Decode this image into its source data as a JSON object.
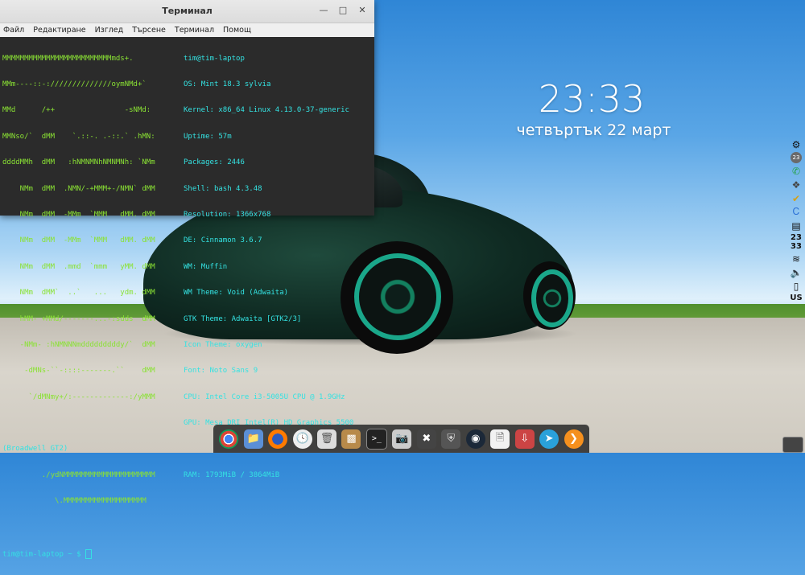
{
  "window": {
    "title": "Терминал",
    "controls": [
      "minimize-icon",
      "maximize-icon",
      "close-icon"
    ],
    "menu": [
      "Файл",
      "Редактиране",
      "Изглед",
      "Търсене",
      "Терминал",
      "Помощ"
    ]
  },
  "terminal": {
    "logo_lines": [
      "MMMMMMMMMMMMMMMMMMMMMMMMMmds+.",
      "MMm----::-://////////////oymNMd+`",
      "MMd      /++                -sNMd:",
      "MMNso/`  dMM    `.::-. .-::.` .hMN:",
      "ddddMMh  dMM   :hNMNMNhNMNMNh: `NMm",
      "    NMm  dMM  .NMN/-+MMM+-/NMN` dMM",
      "    NMm  dMM  -MMm  `MMM   dMM. dMM",
      "    NMm  dMM  -MMm  `MMM   dMM. dMM",
      "    NMm  dMM  .mmd  `mmm   yMM. dMM",
      "    NMm  dMM`  ..`   ...   ydm. dMM",
      "    hMM- +MMd/-------...-:sdds  dMM",
      "    -NMm- :hNMNNNmdddddddddy/`  dMM",
      "     -dMNs-``-::::-------.``    dMM",
      "      `/dMNmy+/:-------------:/yMMM",
      "",
      "         ./ydNMMMMMMMMMMMMMMMMMMMMM",
      "            \\.MMMMMMMMMMMMMMMMMMM"
    ],
    "user_host": "tim@tim-laptop",
    "info": [
      {
        "label": "OS:",
        "value": "Mint 18.3 sylvia"
      },
      {
        "label": "Kernel:",
        "value": "x86_64 Linux 4.13.0-37-generic"
      },
      {
        "label": "Uptime:",
        "value": "57m"
      },
      {
        "label": "Packages:",
        "value": "2446"
      },
      {
        "label": "Shell:",
        "value": "bash 4.3.48"
      },
      {
        "label": "Resolution:",
        "value": "1366x768"
      },
      {
        "label": "DE:",
        "value": "Cinnamon 3.6.7"
      },
      {
        "label": "WM:",
        "value": "Muffin"
      },
      {
        "label": "WM Theme:",
        "value": "Void (Adwaita)"
      },
      {
        "label": "GTK Theme:",
        "value": "Adwaita [GTK2/3]"
      },
      {
        "label": "Icon Theme:",
        "value": "oxygen"
      },
      {
        "label": "Font:",
        "value": "Noto Sans 9"
      },
      {
        "label": "CPU:",
        "value": "Intel Core i3-5005U CPU @ 1.9GHz"
      },
      {
        "label": "GPU:",
        "value": "Mesa DRI Intel(R) HD Graphics 5500"
      },
      {
        "label": "",
        "value": ""
      },
      {
        "label": "RAM:",
        "value": "1793MiB / 3864MiB"
      }
    ],
    "gpu_wrap": "(Broadwell GT2)",
    "prompt": "tim@tim-laptop ~ $"
  },
  "desklet": {
    "time": "23:33",
    "date": "четвъртък   22 март"
  },
  "right_panel": {
    "badge_count": "23",
    "clock_hour": "23",
    "clock_min": "33",
    "keyboard_layout": "US"
  },
  "dock": {
    "apps": [
      "chrome-icon",
      "files-icon",
      "firefox-icon",
      "clock-icon",
      "trash-icon",
      "archive-icon",
      "terminal-icon",
      "screenshot-icon",
      "tools-icon",
      "shield-icon",
      "steam-icon",
      "document-icon",
      "installer-icon",
      "telegram-icon",
      "play-icon"
    ]
  },
  "colors": {
    "terminal_bg": "#2b2b2b",
    "logo_green": "#8ae234",
    "info_cyan": "#34e2e2"
  }
}
